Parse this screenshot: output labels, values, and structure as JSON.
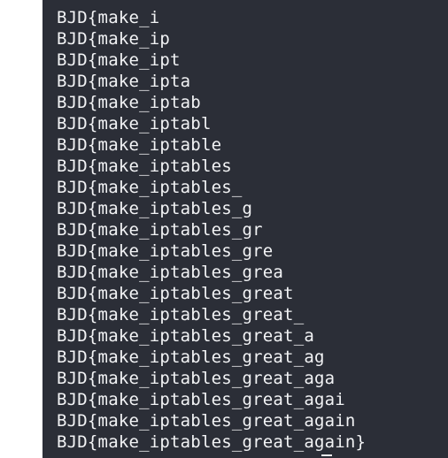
{
  "terminal": {
    "lines": [
      "BJD{make_i",
      "BJD{make_ip",
      "BJD{make_ipt",
      "BJD{make_ipta",
      "BJD{make_iptab",
      "BJD{make_iptabl",
      "BJD{make_iptable",
      "BJD{make_iptables",
      "BJD{make_iptables_",
      "BJD{make_iptables_g",
      "BJD{make_iptables_gr",
      "BJD{make_iptables_gre",
      "BJD{make_iptables_grea",
      "BJD{make_iptables_great",
      "BJD{make_iptables_great_",
      "BJD{make_iptables_great_a",
      "BJD{make_iptables_great_ag",
      "BJD{make_iptables_great_aga",
      "BJD{make_iptables_great_agai",
      "BJD{make_iptables_great_again",
      "BJD{make_iptables_great_again}"
    ]
  }
}
